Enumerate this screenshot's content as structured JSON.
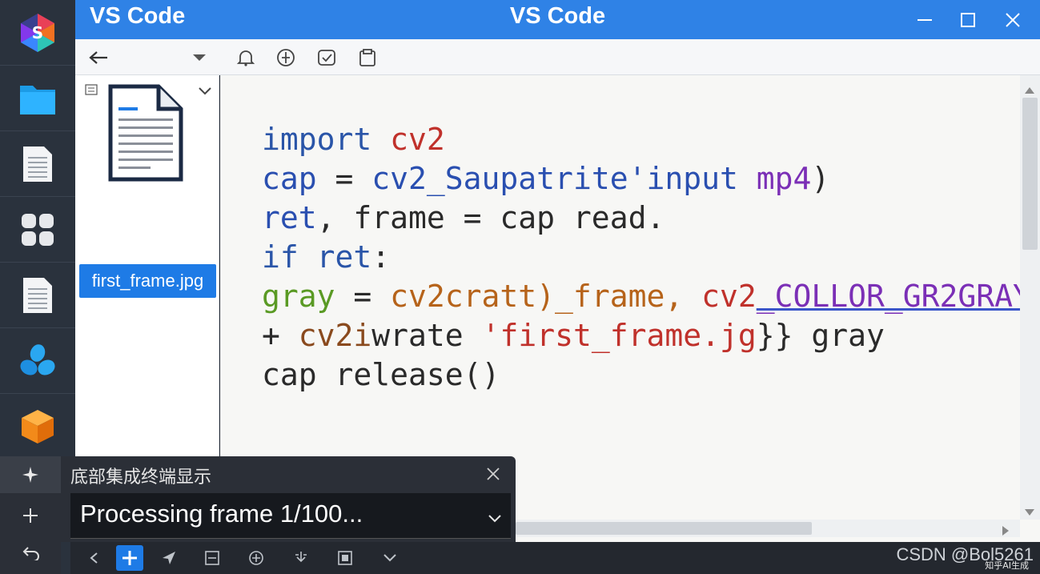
{
  "window": {
    "app_title": "VS Code",
    "center_title": "VS Code"
  },
  "explorer": {
    "file_name": "first_frame.jpg"
  },
  "editor": {
    "lines": [
      [
        {
          "t": "import ",
          "c": "kw"
        },
        {
          "t": "cv2",
          "c": "red"
        }
      ],
      [
        {
          "t": "cap",
          "c": "blue"
        },
        {
          "t": " = ",
          "c": ""
        },
        {
          "t": "cv2_Saupatrite'input ",
          "c": "blue"
        },
        {
          "t": "mp4",
          "c": "purple"
        },
        {
          "t": ")",
          "c": ""
        }
      ],
      [
        {
          "t": "ret",
          "c": "blue"
        },
        {
          "t": ", frame = cap read.",
          "c": ""
        }
      ],
      [
        {
          "t": "if ret",
          "c": "kw"
        },
        {
          "t": ":",
          "c": ""
        }
      ],
      [
        {
          "t": "gray",
          "c": "green"
        },
        {
          "t": " = ",
          "c": ""
        },
        {
          "t": "cv2cratt)_frame, ",
          "c": "orange"
        },
        {
          "t": "cv2",
          "c": "red"
        },
        {
          "t": "_COLLOR_GR2GRAY",
          "c": "purple ul"
        },
        {
          "t": ")",
          "c": ""
        }
      ],
      [
        {
          "t": "+ ",
          "c": ""
        },
        {
          "t": "cv2i",
          "c": "brown"
        },
        {
          "t": "wrate ",
          "c": ""
        },
        {
          "t": "'first_frame.jg",
          "c": "red"
        },
        {
          "t": "}} gray",
          "c": ""
        }
      ],
      [
        {
          "t": "cap release()",
          "c": ""
        }
      ]
    ]
  },
  "terminal": {
    "title": "底部集成终端显示",
    "output": "Processing frame 1/100..."
  },
  "watermark": {
    "text": "CSDN @Bol5261",
    "sub": "知乎AI生成"
  },
  "colors": {
    "titlebar": "#2f82e6",
    "selection": "#1e7be6",
    "activity_bg": "#2a323d"
  }
}
